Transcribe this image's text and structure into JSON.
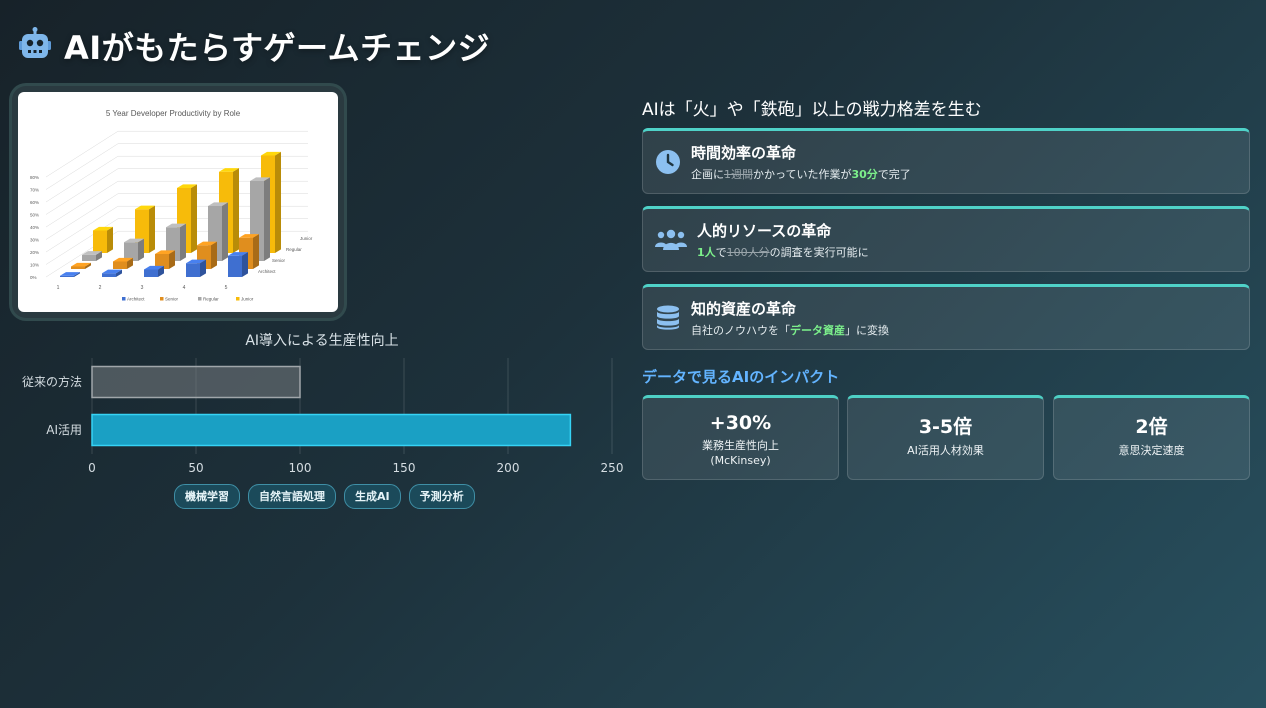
{
  "header": {
    "title": "AIがもたらすゲームチェンジ",
    "icon": "robot-icon"
  },
  "left": {
    "image_chart": {
      "title": "5 Year Developer Productivity by Role",
      "y_ticks": [
        "0%",
        "10%",
        "20%",
        "30%",
        "40%",
        "50%",
        "60%",
        "70%",
        "80%"
      ],
      "x_ticks": [
        "1",
        "2",
        "3",
        "4",
        "5"
      ],
      "depth_labels": [
        "Architect",
        "Senior",
        "Regular",
        "Junior"
      ],
      "legend": [
        "Architect",
        "Senior",
        "Regular",
        "Junior"
      ]
    },
    "bar_chart_title": "AI導入による生産性向上",
    "tags": [
      "機械学習",
      "自然言語処理",
      "生成AI",
      "予測分析"
    ]
  },
  "chart_data": [
    {
      "type": "bar",
      "orientation": "horizontal",
      "title": "AI導入による生産性向上",
      "categories": [
        "従来の方法",
        "AI活用"
      ],
      "values": [
        100,
        230
      ],
      "xlim": [
        0,
        250
      ],
      "x_ticks": [
        "0",
        "50",
        "100",
        "150",
        "200",
        "250"
      ],
      "grid": true,
      "colors": [
        "#5c6368",
        "#1aa0c4"
      ]
    },
    {
      "type": "bar",
      "style": "3d-column",
      "title": "5 Year Developer Productivity by Role",
      "categories": [
        "1",
        "2",
        "3",
        "4",
        "5"
      ],
      "ylim": [
        0,
        80
      ],
      "series": [
        {
          "name": "Architect",
          "color": "#3f6fd0",
          "values": [
            1,
            3,
            6,
            11,
            17
          ]
        },
        {
          "name": "Senior",
          "color": "#e08e1e",
          "values": [
            2,
            6,
            12,
            19,
            25
          ]
        },
        {
          "name": "Regular",
          "color": "#a6a6a6",
          "values": [
            5,
            15,
            27,
            44,
            64
          ]
        },
        {
          "name": "Junior",
          "color": "#f7bb0a",
          "values": [
            18,
            35,
            52,
            65,
            78
          ]
        }
      ],
      "legend_position": "bottom"
    }
  ],
  "right": {
    "heading": "AIは「火」や「鉄砲」以上の戦力格差を生む",
    "cards": [
      {
        "icon": "clock-icon",
        "title": "時間効率の革命",
        "desc_pre": "企画に",
        "desc_strike": "1週間",
        "desc_mid": "かかっていた作業が",
        "desc_hl": "30分",
        "desc_post": "で完了"
      },
      {
        "icon": "users-icon",
        "title": "人的リソースの革命",
        "desc_hl": "1人",
        "desc_mid": "で",
        "desc_strike": "100人分",
        "desc_post": "の調査を実行可能に"
      },
      {
        "icon": "database-icon",
        "title": "知的資産の革命",
        "desc_pre": "自社のノウハウを「",
        "desc_hl": "データ資産",
        "desc_post": "」に変換"
      }
    ],
    "impact_heading": "データで見るAIのインパクト",
    "stats": [
      {
        "value": "+30%",
        "label": "業務生産性向上",
        "label2": "(McKinsey)"
      },
      {
        "value": "3-5倍",
        "label": "AI活用人材効果"
      },
      {
        "value": "2倍",
        "label": "意思決定速度"
      }
    ]
  },
  "colors": {
    "accent_teal": "#4fd2c8",
    "accent_blue": "#63b4ff",
    "highlight_green": "#7cf08b"
  }
}
